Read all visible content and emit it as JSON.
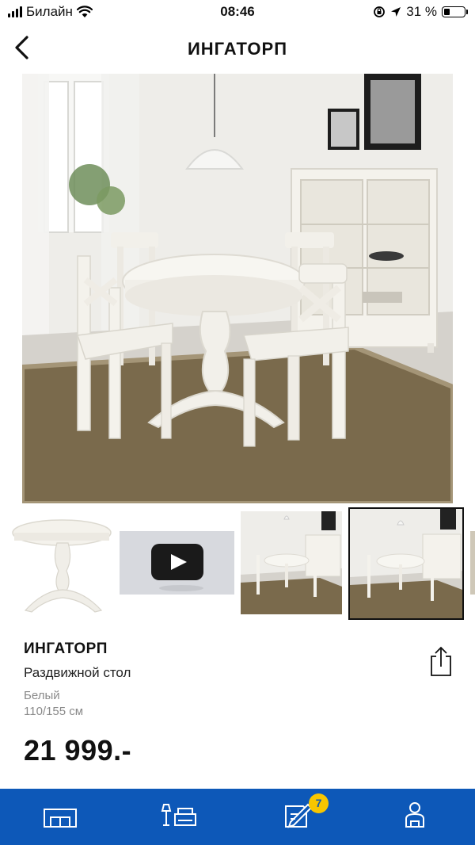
{
  "status_bar": {
    "carrier": "Билайн",
    "time": "08:46",
    "battery_percent": "31 %",
    "battery_level": 0.31
  },
  "nav": {
    "title": "ИНГАТОРП",
    "back_icon": "chevron-left-icon"
  },
  "gallery": {
    "thumbnails": [
      {
        "kind": "product-photo",
        "label": "table-photo",
        "selected": false
      },
      {
        "kind": "video",
        "label": "video-thumbnail",
        "selected": false
      },
      {
        "kind": "room-photo",
        "label": "room-photo",
        "selected": false
      },
      {
        "kind": "room-photo",
        "label": "room-photo",
        "selected": true
      }
    ]
  },
  "product": {
    "name": "ИНГАТОРП",
    "type": "Раздвижной стол",
    "color": "Белый",
    "size": "110/155 см",
    "price": "21 999.-"
  },
  "tabbar": {
    "tabs": [
      {
        "name": "room-icon"
      },
      {
        "name": "furniture-icon"
      },
      {
        "name": "shopping-list-icon",
        "badge": "7"
      },
      {
        "name": "profile-icon"
      }
    ],
    "background": "#0d58b8",
    "badge_color": "#f7c600"
  }
}
